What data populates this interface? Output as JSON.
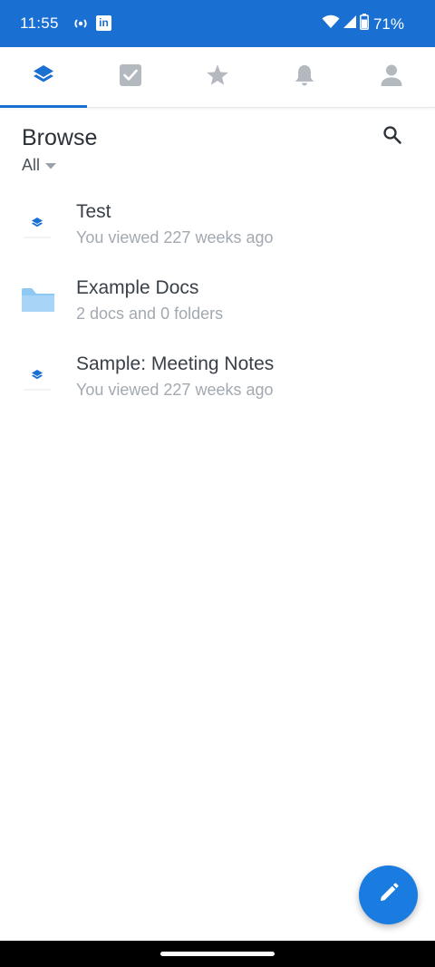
{
  "status": {
    "time": "11:55",
    "linkedin_glyph": "in",
    "battery": "71%",
    "icons": [
      "radio-icon",
      "linkedin-icon",
      "wifi-icon",
      "signal-icon",
      "battery-icon"
    ]
  },
  "tabs": [
    {
      "name": "browse",
      "icon": "layers-icon",
      "active": true
    },
    {
      "name": "tasks",
      "icon": "checkbox-icon",
      "active": false
    },
    {
      "name": "starred",
      "icon": "star-icon",
      "active": false
    },
    {
      "name": "notifications",
      "icon": "bell-icon",
      "active": false
    },
    {
      "name": "profile",
      "icon": "person-icon",
      "active": false
    }
  ],
  "header": {
    "title": "Browse",
    "filter_label": "All"
  },
  "items": [
    {
      "title": "Test",
      "subtitle": "You viewed 227 weeks ago",
      "icon": "document-icon"
    },
    {
      "title": "Example Docs",
      "subtitle": "2 docs and 0 folders",
      "icon": "folder-icon"
    },
    {
      "title": "Sample: Meeting Notes",
      "subtitle": "You viewed 227 weeks ago",
      "icon": "document-icon"
    }
  ],
  "colors": {
    "accent": "#1a6fd2",
    "fab": "#1a7be0",
    "inactive_icon": "#b3b9bf",
    "folder": "#8ec8f4"
  }
}
